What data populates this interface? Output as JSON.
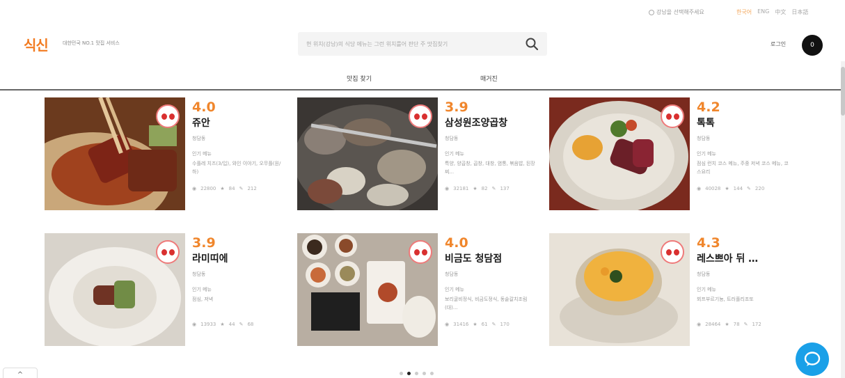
{
  "util": {
    "location_label": "강남을 선택해주세요",
    "languages": [
      "한국어",
      "ENG",
      "中文",
      "日本語"
    ]
  },
  "header": {
    "logo": "식신",
    "tagline": "대한민국 NO.1 맛집 서비스",
    "search_placeholder": "현 위치(강남)의 식당 메뉴는 그런 위치를어 판단 주 맛집찾기",
    "login_label": "로그인",
    "avatar_label": "0"
  },
  "nav": {
    "tabs": [
      "맛집 찾기",
      "매거진"
    ]
  },
  "restaurants": [
    {
      "rating": "4.0",
      "name": "쥬안",
      "area": "청담동",
      "menu_label": "인기 메뉴",
      "menu": "수플레 치즈(3/입), 와인 이야기, 오무플(원/하)",
      "views": "22800",
      "likes": "84",
      "reviews": "212"
    },
    {
      "rating": "3.9",
      "name": "삼성원조양곱창",
      "area": "청담동",
      "menu_label": "인기 메뉴",
      "menu": "특양, 양곱창, 곱창, 대창, 염통, 볶음밥, 된장찌...",
      "views": "32181",
      "likes": "82",
      "reviews": "137"
    },
    {
      "rating": "4.2",
      "name": "톡톡",
      "area": "청담동",
      "menu_label": "인기 메뉴",
      "menu": "점심 런치 코스 메뉴, 주중 저녁 코스 메뉴, 코스요리",
      "views": "40028",
      "likes": "144",
      "reviews": "220"
    },
    {
      "rating": "3.9",
      "name": "라미띠에",
      "area": "청담동",
      "menu_label": "인기 메뉴",
      "menu": "점심, 저녁",
      "views": "13933",
      "likes": "44",
      "reviews": "68"
    },
    {
      "rating": "4.0",
      "name": "비금도 청담점",
      "area": "청담동",
      "menu_label": "인기 메뉴",
      "menu": "보리굴비정식, 비금도정식, 동솥갈치조림(대)...",
      "views": "31416",
      "likes": "61",
      "reviews": "170"
    },
    {
      "rating": "4.3",
      "name": "레스쁘아 뒤 …",
      "area": "청담동",
      "menu_label": "인기 메뉴",
      "menu": "뵈프부르기뇽, 트러플리조또",
      "views": "28464",
      "likes": "78",
      "reviews": "172"
    }
  ],
  "pagination": {
    "total": 5,
    "active": 1
  },
  "up_label": "^"
}
